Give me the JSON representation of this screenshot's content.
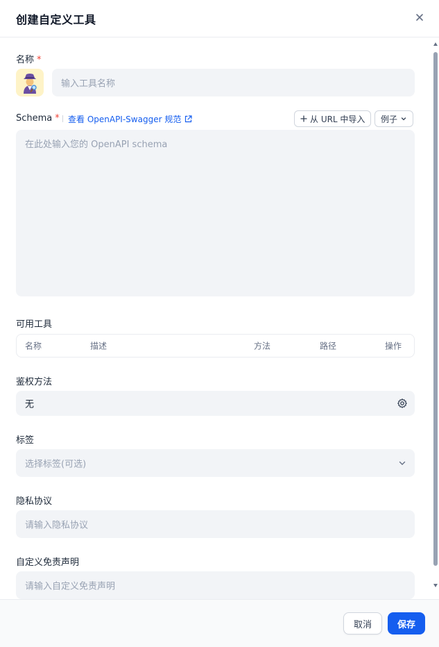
{
  "dialog": {
    "title": "创建自定义工具",
    "close_icon": "close-icon"
  },
  "form": {
    "name": {
      "label": "名称",
      "required_mark": "*",
      "avatar_icon": "detective-emoji-icon",
      "placeholder": "输入工具名称"
    },
    "schema": {
      "label": "Schema",
      "required_mark": "*",
      "spec_link": "查看 OpenAPI-Swagger 规范",
      "import_url_button": "从 URL 中导入",
      "examples_button": "例子",
      "placeholder": "在此处输入您的 OpenAPI schema"
    },
    "available_tools": {
      "label": "可用工具",
      "columns": [
        "名称",
        "描述",
        "方法",
        "路径",
        "操作"
      ]
    },
    "auth": {
      "label": "鉴权方法",
      "value": "无"
    },
    "tags": {
      "label": "标签",
      "placeholder": "选择标签(可选)"
    },
    "privacy": {
      "label": "隐私协议",
      "placeholder": "请输入隐私协议"
    },
    "disclaimer": {
      "label": "自定义免责声明",
      "placeholder": "请输入自定义免责声明"
    }
  },
  "footer": {
    "cancel_label": "取消",
    "save_label": "保存"
  },
  "colors": {
    "primary": "#155eef",
    "required": "#f04438",
    "field_bg": "#f2f4f7"
  }
}
